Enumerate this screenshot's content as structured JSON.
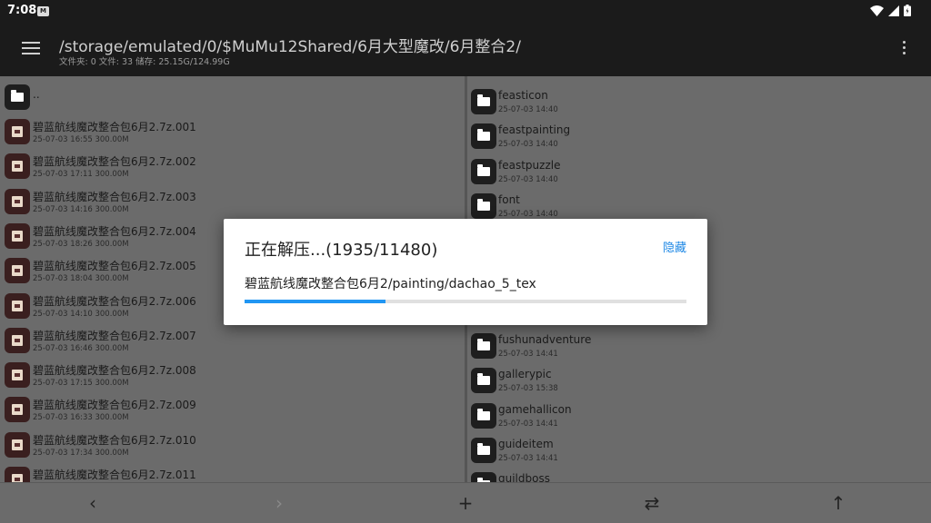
{
  "status": {
    "time": "7:08",
    "notif_icon": "notification-icon",
    "icons": [
      "wifi-icon",
      "signal-icon",
      "battery-icon"
    ]
  },
  "header": {
    "path": "/storage/emulated/0/$MuMu12Shared/6月大型魔改/6月整合2/",
    "info": "文件夹: 0  文件: 33  储存: 25.15G/124.99G"
  },
  "left_pane": {
    "parent": "..",
    "items": [
      {
        "name": "碧蓝航线魔改整合包6月2.7z.001",
        "meta": "25-07-03 16:55  300.00M"
      },
      {
        "name": "碧蓝航线魔改整合包6月2.7z.002",
        "meta": "25-07-03 17:11  300.00M"
      },
      {
        "name": "碧蓝航线魔改整合包6月2.7z.003",
        "meta": "25-07-03 14:16  300.00M"
      },
      {
        "name": "碧蓝航线魔改整合包6月2.7z.004",
        "meta": "25-07-03 18:26  300.00M"
      },
      {
        "name": "碧蓝航线魔改整合包6月2.7z.005",
        "meta": "25-07-03 18:04  300.00M"
      },
      {
        "name": "碧蓝航线魔改整合包6月2.7z.006",
        "meta": "25-07-03 14:10  300.00M"
      },
      {
        "name": "碧蓝航线魔改整合包6月2.7z.007",
        "meta": "25-07-03 16:46  300.00M"
      },
      {
        "name": "碧蓝航线魔改整合包6月2.7z.008",
        "meta": "25-07-03 17:15  300.00M"
      },
      {
        "name": "碧蓝航线魔改整合包6月2.7z.009",
        "meta": "25-07-03 16:33  300.00M"
      },
      {
        "name": "碧蓝航线魔改整合包6月2.7z.010",
        "meta": "25-07-03 17:34  300.00M"
      },
      {
        "name": "碧蓝航线魔改整合包6月2.7z.011",
        "meta": ""
      }
    ]
  },
  "right_pane": {
    "items": [
      {
        "name": "feasticon",
        "meta": "25-07-03 14:40"
      },
      {
        "name": "feastpainting",
        "meta": "25-07-03 14:40"
      },
      {
        "name": "feastpuzzle",
        "meta": "25-07-03 14:40"
      },
      {
        "name": "font",
        "meta": "25-07-03 14:40"
      },
      {
        "name": "fushunadventure",
        "meta": "25-07-03 14:41"
      },
      {
        "name": "gallerypic",
        "meta": "25-07-03 15:38"
      },
      {
        "name": "gamehallicon",
        "meta": "25-07-03 14:41"
      },
      {
        "name": "guideitem",
        "meta": "25-07-03 14:41"
      },
      {
        "name": "guildboss",
        "meta": ""
      }
    ]
  },
  "dialog": {
    "title": "正在解压...(1935/11480)",
    "hide_label": "隐藏",
    "current_file": "碧蓝航线魔改整合包6月2/painting/dachao_5_tex",
    "progress": 0.3182
  },
  "bottom_bar": {
    "back": "‹",
    "forward": "›",
    "add": "+",
    "swap": "⇄",
    "up": "↑"
  }
}
